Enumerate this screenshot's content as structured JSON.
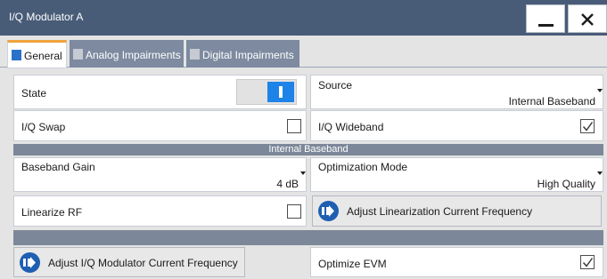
{
  "window": {
    "title": "I/Q Modulator A",
    "minimize_icon": "minimize-icon",
    "close_icon": "close-x-icon"
  },
  "tabs": [
    {
      "label": "General",
      "active": true
    },
    {
      "label": "Analog Impairments",
      "active": false
    },
    {
      "label": "Digital Impairments",
      "active": false
    }
  ],
  "general": {
    "state": {
      "label": "State",
      "on": true
    },
    "source": {
      "label": "Source",
      "value": "Internal Baseband"
    },
    "iq_swap": {
      "label": "I/Q Swap",
      "checked": false
    },
    "iq_wideband": {
      "label": "I/Q Wideband",
      "checked": true
    },
    "internal_baseband_header": "Internal Baseband",
    "baseband_gain": {
      "label": "Baseband Gain",
      "value": "4 dB"
    },
    "optimization_mode": {
      "label": "Optimization Mode",
      "value": "High Quality"
    },
    "linearize_rf": {
      "label": "Linearize RF",
      "checked": false
    },
    "adjust_linearization_button": "Adjust Linearization Current Frequency",
    "adjust_iq_modulator_button": "Adjust I/Q Modulator Current Frequency",
    "optimize_evm": {
      "label": "Optimize EVM",
      "checked": true
    }
  },
  "colors": {
    "titlebar": "#485c78",
    "accent_tab": "#f0a23c",
    "toggle_on": "#1d83e8",
    "action_icon": "#1e5fb2",
    "section_band": "#7c8899"
  }
}
